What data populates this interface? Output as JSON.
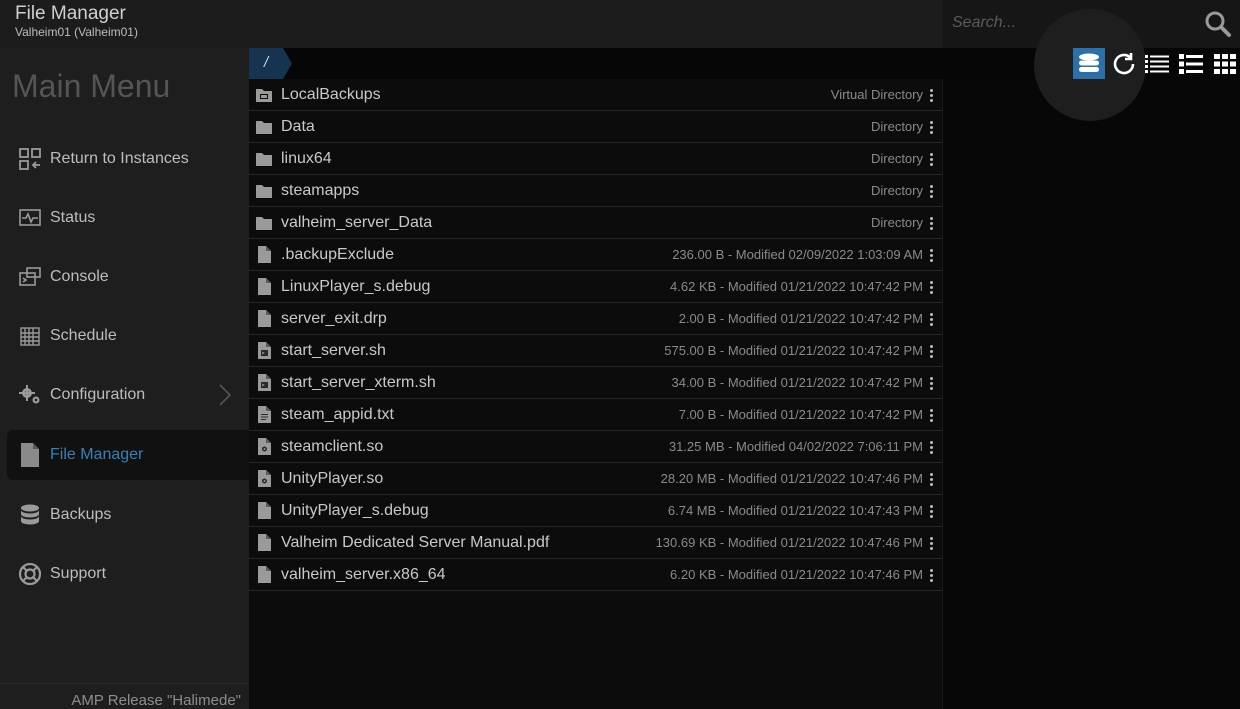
{
  "header": {
    "title": "File Manager",
    "subtitle": "Valheim01 (Valheim01)"
  },
  "search": {
    "placeholder": "Search...",
    "icon": "search-icon"
  },
  "sidebar": {
    "title": "Main Menu",
    "items": [
      {
        "label": "Return to Instances",
        "icon": "instances-icon"
      },
      {
        "label": "Status",
        "icon": "status-icon"
      },
      {
        "label": "Console",
        "icon": "console-icon"
      },
      {
        "label": "Schedule",
        "icon": "schedule-icon"
      },
      {
        "label": "Configuration",
        "icon": "gears-icon"
      },
      {
        "label": "File Manager",
        "icon": "file-icon",
        "active": true
      },
      {
        "label": "Backups",
        "icon": "database-icon"
      },
      {
        "label": "Support",
        "icon": "lifebuoy-icon"
      }
    ],
    "footer": "AMP Release \"Halimede\""
  },
  "breadcrumb": {
    "root": "/"
  },
  "toolbar": {
    "buttons": [
      "datastore-icon",
      "refresh-icon",
      "list-view-icon",
      "detail-view-icon",
      "grid-view-icon"
    ],
    "active": "datastore-icon",
    "accent": "#2f6fa8"
  },
  "files": [
    {
      "name": "LocalBackups",
      "meta": "Virtual Directory",
      "type": "virtual-folder"
    },
    {
      "name": "Data",
      "meta": "Directory",
      "type": "folder"
    },
    {
      "name": "linux64",
      "meta": "Directory",
      "type": "folder"
    },
    {
      "name": "steamapps",
      "meta": "Directory",
      "type": "folder"
    },
    {
      "name": "valheim_server_Data",
      "meta": "Directory",
      "type": "folder"
    },
    {
      "name": ".backupExclude",
      "meta": "236.00 B - Modified 02/09/2022 1:03:09 AM",
      "type": "file"
    },
    {
      "name": "LinuxPlayer_s.debug",
      "meta": "4.62 KB - Modified 01/21/2022 10:47:42 PM",
      "type": "file"
    },
    {
      "name": "server_exit.drp",
      "meta": "2.00 B - Modified 01/21/2022 10:47:42 PM",
      "type": "file"
    },
    {
      "name": "start_server.sh",
      "meta": "575.00 B - Modified 01/21/2022 10:47:42 PM",
      "type": "script"
    },
    {
      "name": "start_server_xterm.sh",
      "meta": "34.00 B - Modified 01/21/2022 10:47:42 PM",
      "type": "script"
    },
    {
      "name": "steam_appid.txt",
      "meta": "7.00 B - Modified 01/21/2022 10:47:42 PM",
      "type": "text"
    },
    {
      "name": "steamclient.so",
      "meta": "31.25 MB - Modified 04/02/2022 7:06:11 PM",
      "type": "binary"
    },
    {
      "name": "UnityPlayer.so",
      "meta": "28.20 MB - Modified 01/21/2022 10:47:46 PM",
      "type": "binary"
    },
    {
      "name": "UnityPlayer_s.debug",
      "meta": "6.74 MB - Modified 01/21/2022 10:47:43 PM",
      "type": "file"
    },
    {
      "name": "Valheim Dedicated Server Manual.pdf",
      "meta": "130.69 KB - Modified 01/21/2022 10:47:46 PM",
      "type": "file"
    },
    {
      "name": "valheim_server.x86_64",
      "meta": "6.20 KB - Modified 01/21/2022 10:47:46 PM",
      "type": "file"
    }
  ]
}
